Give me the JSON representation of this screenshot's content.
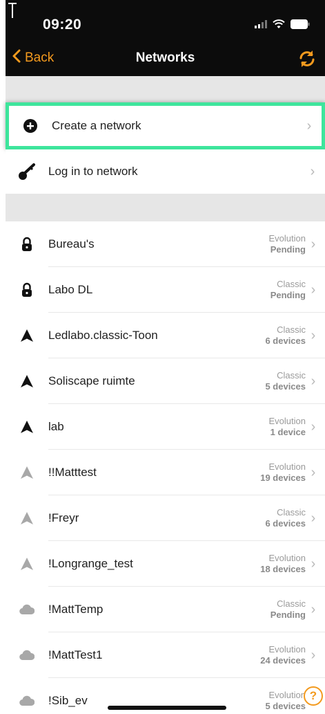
{
  "status_bar": {
    "time": "09:20"
  },
  "nav": {
    "back_label": "Back",
    "title": "Networks",
    "sync_icon": "sync-icon"
  },
  "actions": {
    "create": {
      "label": "Create a network",
      "icon": "plus-circle-icon"
    },
    "login": {
      "label": "Log in to network",
      "icon": "key-icon"
    }
  },
  "networks": [
    {
      "name": "Bureau's",
      "type": "Evolution",
      "status": "Pending",
      "icon": "lock-icon"
    },
    {
      "name": "Labo DL",
      "type": "Classic",
      "status": "Pending",
      "icon": "lock-icon"
    },
    {
      "name": "Ledlabo.classic-Toon",
      "type": "Classic",
      "status": "6 devices",
      "icon": "arrow-up-icon"
    },
    {
      "name": "Soliscape ruimte",
      "type": "Classic",
      "status": "5 devices",
      "icon": "arrow-up-icon"
    },
    {
      "name": "lab",
      "type": "Evolution",
      "status": "1 device",
      "icon": "arrow-up-icon"
    },
    {
      "name": "!!Matttest",
      "type": "Evolution",
      "status": "19 devices",
      "icon": "arrow-up-gray-icon"
    },
    {
      "name": "!Freyr",
      "type": "Classic",
      "status": "6 devices",
      "icon": "arrow-up-gray-icon"
    },
    {
      "name": "!Longrange_test",
      "type": "Evolution",
      "status": "18 devices",
      "icon": "arrow-up-gray-icon"
    },
    {
      "name": "!MattTemp",
      "type": "Classic",
      "status": "Pending",
      "icon": "cloud-icon"
    },
    {
      "name": "!MattTest1",
      "type": "Evolution",
      "status": "24 devices",
      "icon": "cloud-icon"
    },
    {
      "name": "!Sib_ev",
      "type": "Evolution",
      "status": "5 devices",
      "icon": "cloud-icon"
    }
  ],
  "help": {
    "label": "?"
  },
  "colors": {
    "accent": "#f39a1e",
    "highlight": "#3ee59c",
    "header_bg": "#0c0c0c",
    "band": "#e6e6e6"
  }
}
